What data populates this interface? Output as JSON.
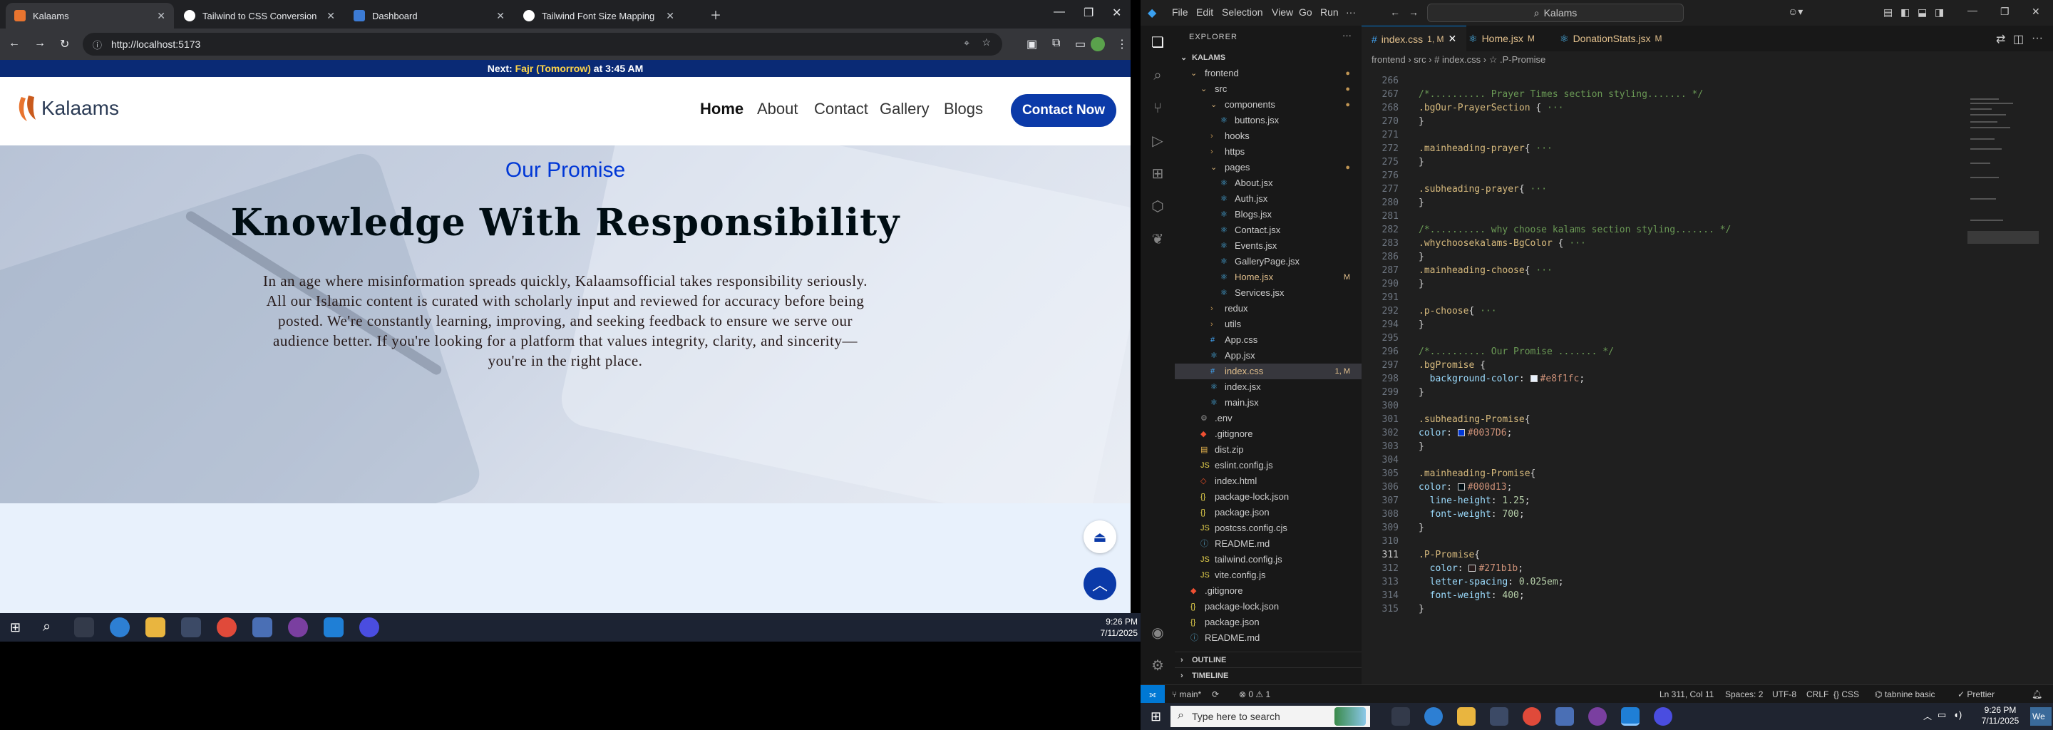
{
  "browser": {
    "tabs": [
      {
        "title": "Kalaams",
        "active": true,
        "color": "#e8742f"
      },
      {
        "title": "Tailwind to CSS Conversion",
        "active": false,
        "color": "#ffffff"
      },
      {
        "title": "Dashboard",
        "active": false,
        "color": "#3c7bd4"
      },
      {
        "title": "Tailwind Font Size Mapping",
        "active": false,
        "color": "#ffffff"
      }
    ],
    "url": "http://localhost:5173"
  },
  "site": {
    "announcement_prefix": "Next: ",
    "announcement_highlight": "Fajr (Tomorrow)",
    "announcement_suffix": " at 3:45 AM",
    "logo_text": "Kalaams",
    "nav": [
      "Home",
      "About",
      "Contact",
      "Gallery",
      "Blogs"
    ],
    "contact_button": "Contact Now",
    "promise": {
      "subheading": "Our Promise",
      "heading": "Knowledge With Responsibility",
      "paragraph": "In an age where misinformation spreads quickly, Kalaamsofficial takes responsibility seriously. All our Islamic content is curated with scholarly input and reviewed for accuracy before being posted. We're constantly learning, improving, and seeking feedback to ensure we serve our audience better. If you're looking for a platform that values integrity, clarity, and sincerity—you're in the right place."
    }
  },
  "inner_taskbar": {
    "time": "9:26 PM",
    "date": "7/11/2025"
  },
  "vscode": {
    "menu": [
      "File",
      "Edit",
      "Selection",
      "View",
      "Go",
      "Run",
      "···"
    ],
    "search": "Kalams",
    "explorer_title": "EXPLORER",
    "workspace": "KALAMS",
    "tree": [
      {
        "label": "frontend",
        "indent": 1,
        "kind": "folder-open",
        "badge": "●"
      },
      {
        "label": "src",
        "indent": 2,
        "kind": "folder-open",
        "badge": "●"
      },
      {
        "label": "components",
        "indent": 3,
        "kind": "folder-open",
        "badge": "●"
      },
      {
        "label": "buttons.jsx",
        "indent": 4,
        "kind": "jsx",
        "badge": ""
      },
      {
        "label": "hooks",
        "indent": 3,
        "kind": "folder",
        "badge": ""
      },
      {
        "label": "https",
        "indent": 3,
        "kind": "folder",
        "badge": ""
      },
      {
        "label": "pages",
        "indent": 3,
        "kind": "folder-open",
        "badge": "●"
      },
      {
        "label": "About.jsx",
        "indent": 4,
        "kind": "jsx",
        "badge": ""
      },
      {
        "label": "Auth.jsx",
        "indent": 4,
        "kind": "jsx",
        "badge": ""
      },
      {
        "label": "Blogs.jsx",
        "indent": 4,
        "kind": "jsx",
        "badge": ""
      },
      {
        "label": "Contact.jsx",
        "indent": 4,
        "kind": "jsx",
        "badge": ""
      },
      {
        "label": "Events.jsx",
        "indent": 4,
        "kind": "jsx",
        "badge": ""
      },
      {
        "label": "GalleryPage.jsx",
        "indent": 4,
        "kind": "jsx",
        "badge": ""
      },
      {
        "label": "Home.jsx",
        "indent": 4,
        "kind": "jsx",
        "badge": "M"
      },
      {
        "label": "Services.jsx",
        "indent": 4,
        "kind": "jsx",
        "badge": ""
      },
      {
        "label": "redux",
        "indent": 3,
        "kind": "folder",
        "badge": ""
      },
      {
        "label": "utils",
        "indent": 3,
        "kind": "folder",
        "badge": ""
      },
      {
        "label": "App.css",
        "indent": 3,
        "kind": "css",
        "badge": ""
      },
      {
        "label": "App.jsx",
        "indent": 3,
        "kind": "jsx",
        "badge": ""
      },
      {
        "label": "index.css",
        "indent": 3,
        "kind": "css",
        "badge": "1, M",
        "selected": true
      },
      {
        "label": "index.jsx",
        "indent": 3,
        "kind": "jsx",
        "badge": ""
      },
      {
        "label": "main.jsx",
        "indent": 3,
        "kind": "jsx",
        "badge": ""
      },
      {
        "label": ".env",
        "indent": 2,
        "kind": "env",
        "badge": ""
      },
      {
        "label": ".gitignore",
        "indent": 2,
        "kind": "git",
        "badge": ""
      },
      {
        "label": "dist.zip",
        "indent": 2,
        "kind": "zip",
        "badge": ""
      },
      {
        "label": "eslint.config.js",
        "indent": 2,
        "kind": "js",
        "badge": ""
      },
      {
        "label": "index.html",
        "indent": 2,
        "kind": "html",
        "badge": ""
      },
      {
        "label": "package-lock.json",
        "indent": 2,
        "kind": "json",
        "badge": ""
      },
      {
        "label": "package.json",
        "indent": 2,
        "kind": "json",
        "badge": ""
      },
      {
        "label": "postcss.config.cjs",
        "indent": 2,
        "kind": "js",
        "badge": ""
      },
      {
        "label": "README.md",
        "indent": 2,
        "kind": "md",
        "badge": ""
      },
      {
        "label": "tailwind.config.js",
        "indent": 2,
        "kind": "js",
        "badge": ""
      },
      {
        "label": "vite.config.js",
        "indent": 2,
        "kind": "js",
        "badge": ""
      },
      {
        "label": ".gitignore",
        "indent": 1,
        "kind": "git",
        "badge": ""
      },
      {
        "label": "package-lock.json",
        "indent": 1,
        "kind": "json",
        "badge": ""
      },
      {
        "label": "package.json",
        "indent": 1,
        "kind": "json",
        "badge": ""
      },
      {
        "label": "README.md",
        "indent": 1,
        "kind": "md",
        "badge": ""
      }
    ],
    "outline": "OUTLINE",
    "timeline": "TIMELINE",
    "editor_tabs": [
      {
        "label": "index.css",
        "badge": "1, M",
        "active": true
      },
      {
        "label": "Home.jsx",
        "badge": "M",
        "active": false
      },
      {
        "label": "DonationStats.jsx",
        "badge": "M",
        "active": false
      }
    ],
    "breadcrumb": "frontend › src › # index.css › ☆ .P-Promise",
    "code": [
      {
        "n": "266",
        "html": ""
      },
      {
        "n": "267",
        "html": "<span class='cm'>/*.......... Prayer Times section styling....... */</span>"
      },
      {
        "n": "268",
        "html": "<span class='sel-c'>.bgOur-PrayerSection</span> { <span class='cm'>···</span>"
      },
      {
        "n": "270",
        "html": "}"
      },
      {
        "n": "271",
        "html": ""
      },
      {
        "n": "272",
        "html": "<span class='sel-c'>.mainheading-prayer</span>{ <span class='cm'>···</span>"
      },
      {
        "n": "275",
        "html": "}"
      },
      {
        "n": "276",
        "html": ""
      },
      {
        "n": "277",
        "html": "<span class='sel-c'>.subheading-prayer</span>{ <span class='cm'>···</span>"
      },
      {
        "n": "280",
        "html": "}"
      },
      {
        "n": "281",
        "html": ""
      },
      {
        "n": "282",
        "html": "<span class='cm'>/*.......... why choose kalams section styling....... */</span>"
      },
      {
        "n": "283",
        "html": "<span class='sel-c'>.whychoosekalams-BgColor</span> { <span class='cm'>···</span>"
      },
      {
        "n": "286",
        "html": "}"
      },
      {
        "n": "287",
        "html": "<span class='sel-c'>.mainheading-choose</span>{ <span class='cm'>···</span>"
      },
      {
        "n": "290",
        "html": "}"
      },
      {
        "n": "291",
        "html": ""
      },
      {
        "n": "292",
        "html": "<span class='sel-c'>.p-choose</span>{ <span class='cm'>···</span>"
      },
      {
        "n": "294",
        "html": "}"
      },
      {
        "n": "295",
        "html": ""
      },
      {
        "n": "296",
        "html": "<span class='cm'>/*.......... Our Promise ....... */</span>"
      },
      {
        "n": "297",
        "html": "<span class='sel-c'>.bgPromise</span> {"
      },
      {
        "n": "298",
        "html": "  <span class='prop'>background-color</span>: <span class='sw' style='background:#e8f1fc'></span><span class='val'>#e8f1fc</span>;"
      },
      {
        "n": "299",
        "html": "}"
      },
      {
        "n": "300",
        "html": ""
      },
      {
        "n": "301",
        "html": "<span class='sel-c'>.subheading-Promise</span>{"
      },
      {
        "n": "302",
        "html": "<span class='prop'>color</span>: <span class='sw' style='background:#0037d6'></span><span class='val'>#0037D6</span>;"
      },
      {
        "n": "303",
        "html": "}"
      },
      {
        "n": "304",
        "html": ""
      },
      {
        "n": "305",
        "html": "<span class='sel-c'>.mainheading-Promise</span>{"
      },
      {
        "n": "306",
        "html": "<span class='prop'>color</span>: <span class='sw' style='background:#000d13'></span><span class='val'>#000d13</span>;"
      },
      {
        "n": "307",
        "html": "  <span class='prop'>line-height</span>: <span class='num'>1.25</span>;"
      },
      {
        "n": "308",
        "html": "  <span class='prop'>font-weight</span>: <span class='num'>700</span>;"
      },
      {
        "n": "309",
        "html": "}"
      },
      {
        "n": "310",
        "html": ""
      },
      {
        "n": "311",
        "html": "<span class='sel-c'>.P-Promise</span>{"
      },
      {
        "n": "312",
        "html": "  <span class='prop'>color</span>: <span class='sw' style='background:#271b1b'></span><span class='val'>#271b1b</span>;"
      },
      {
        "n": "313",
        "html": "  <span class='prop'>letter-spacing</span>: <span class='num'>0.025em</span>;"
      },
      {
        "n": "314",
        "html": "  <span class='prop'>font-weight</span>: <span class='num'>400</span>;"
      },
      {
        "n": "315",
        "html": "}"
      }
    ],
    "status": {
      "branch": "main*",
      "sync": "⟳",
      "problems": "⊗ 0 ⚠ 1",
      "cursor": "Ln 311, Col 11",
      "spaces": "Spaces: 2",
      "encoding": "UTF-8",
      "eol": "CRLF",
      "language": "CSS",
      "tabnine": "tabnine basic",
      "prettier": "✓ Prettier"
    }
  },
  "windows_taskbar": {
    "search_placeholder": "Type here to search",
    "time": "9:26 PM",
    "date": "7/11/2025",
    "corner": "We"
  }
}
